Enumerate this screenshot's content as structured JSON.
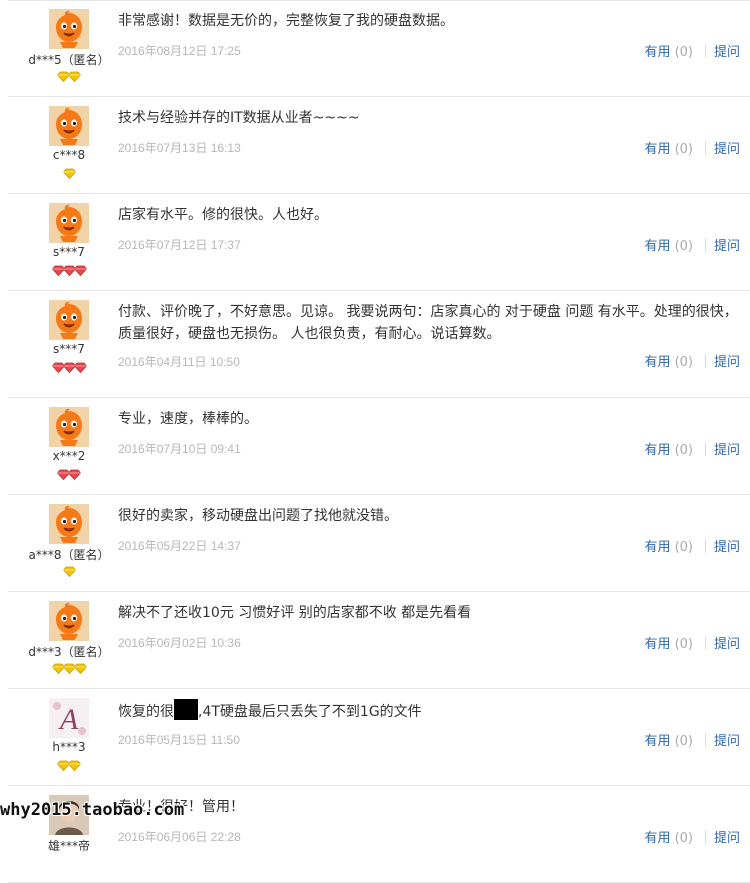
{
  "actions": {
    "useful_label": "有用",
    "ask_label": "提问"
  },
  "watermark": "why2015.taobao.com",
  "colors": {
    "link": "#2f66a8",
    "date": "#b7b7b7",
    "avatar_orange": "#f57a17",
    "diamond_yellow": "#f5c400",
    "heart_red": "#e03a3a"
  },
  "reviews": [
    {
      "user": "d***5（匿名）",
      "avatar": "taobao-baby-icon",
      "rank_icon": "yellow-diamond-icon",
      "rank_count": 2,
      "content": "非常感谢！数据是无价的，完整恢复了我的硬盘数据。",
      "date": "2016年08月12日 17:25",
      "useful_count": "(0)"
    },
    {
      "user": "c***8",
      "avatar": "taobao-baby-icon",
      "rank_icon": "yellow-diamond-icon",
      "rank_count": 1,
      "content": "技术与经验并存的IT数据从业者~~~~",
      "date": "2016年07月13日 16:13",
      "useful_count": "(0)"
    },
    {
      "user": "s***7",
      "avatar": "taobao-baby-icon",
      "rank_icon": "red-heart-icon",
      "rank_count": 3,
      "content": "店家有水平。修的很快。人也好。",
      "date": "2016年07月12日 17:37",
      "useful_count": "(0)"
    },
    {
      "user": "s***7",
      "avatar": "taobao-baby-icon",
      "rank_icon": "red-heart-icon",
      "rank_count": 3,
      "content": "付款、评价晚了，不好意思。见谅。 我要说两句：店家真心的 对于硬盘 问题 有水平。处理的很快，质量很好，硬盘也无损伤。 人也很负责，有耐心。说话算数。",
      "date": "2016年04月11日 10:50",
      "useful_count": "(0)"
    },
    {
      "user": "x***2",
      "avatar": "taobao-baby-icon",
      "rank_icon": "red-heart-icon",
      "rank_count": 2,
      "content": "专业，速度，棒棒的。",
      "date": "2016年07月10日 09:41",
      "useful_count": "(0)"
    },
    {
      "user": "a***8（匿名）",
      "avatar": "taobao-baby-icon",
      "rank_icon": "yellow-diamond-icon",
      "rank_count": 1,
      "content": "很好的卖家，移动硬盘出问题了找他就没错。",
      "date": "2016年05月22日 14:37",
      "useful_count": "(0)"
    },
    {
      "user": "d***3（匿名）",
      "avatar": "taobao-baby-icon",
      "rank_icon": "yellow-diamond-icon",
      "rank_count": 3,
      "content": "解决不了还收10元 习惯好评 别的店家都不收 都是先看看",
      "date": "2016年06月02日 10:36",
      "useful_count": "(0)"
    },
    {
      "user": "h***3",
      "avatar": "letter-a-avatar-icon",
      "rank_icon": "yellow-diamond-icon",
      "rank_count": 2,
      "content_before": "恢复的很",
      "content_after": ",4T硬盘最后只丢失了不到1G的文件",
      "date": "2016年05月15日 11:50",
      "useful_count": "(0)"
    },
    {
      "user": "雄***帝",
      "avatar": "photo-avatar-icon",
      "rank_icon": "",
      "rank_count": 0,
      "content": "专业！很好！管用！",
      "date": "2016年06月06日 22:28",
      "useful_count": "(0)"
    }
  ]
}
